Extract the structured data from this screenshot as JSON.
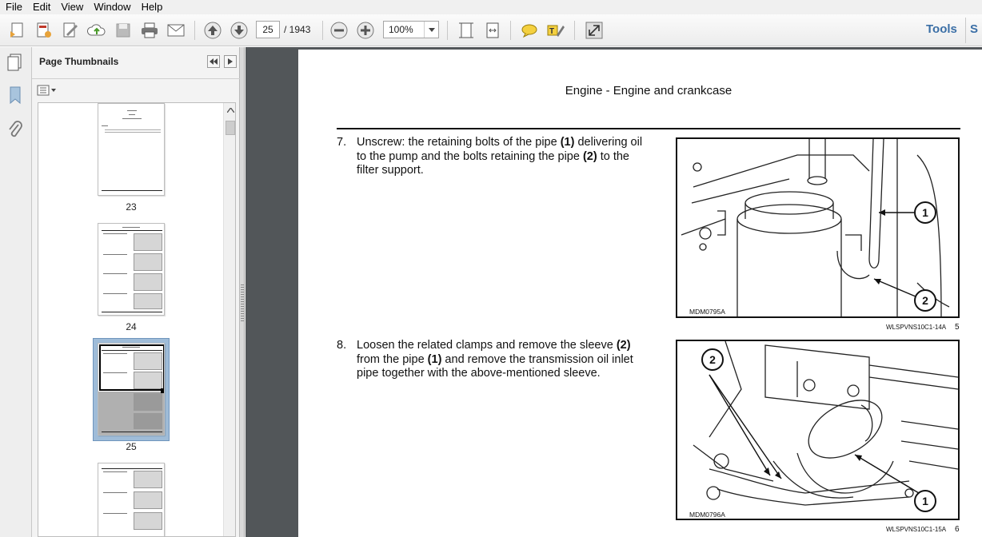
{
  "menu": [
    "File",
    "Edit",
    "View",
    "Window",
    "Help"
  ],
  "toolbar": {
    "icons": [
      "create-icon",
      "edit-pdf-icon",
      "sign-icon",
      "cloud-upload-icon",
      "save-icon",
      "print-icon",
      "email-icon",
      "previous-page-icon",
      "next-page-icon",
      "zoom-out-icon",
      "zoom-in-icon",
      "fit-page-icon",
      "fit-width-icon",
      "comment-icon",
      "highlight-icon",
      "fullscreen-icon"
    ],
    "current_page": "25",
    "page_total": "/ 1943",
    "zoom": "100%",
    "tools_label": "Tools",
    "next_panel_label": "S"
  },
  "thumbnails": {
    "title": "Page Thumbnails",
    "pages": [
      {
        "number": "23",
        "selected": false
      },
      {
        "number": "24",
        "selected": false
      },
      {
        "number": "25",
        "selected": true
      },
      {
        "number": "",
        "selected": false
      }
    ]
  },
  "document": {
    "header": "Engine - Engine and crankcase",
    "steps": [
      {
        "number": "7.",
        "parts": [
          {
            "t": "Unscrew: the retaining bolts of the pipe ",
            "b": false
          },
          {
            "t": "(1)",
            "b": true
          },
          {
            "t": " delivering oil to the pump and the bolts retaining the pipe ",
            "b": false
          },
          {
            "t": "(2)",
            "b": true
          },
          {
            "t": " to the filter support.",
            "b": false
          }
        ],
        "figure_code": "MDM0795A",
        "figure_ref": "WLSPVNS10C1-14A",
        "figure_num": "5",
        "callouts": [
          "1",
          "2"
        ]
      },
      {
        "number": "8.",
        "parts": [
          {
            "t": "Loosen the related clamps and remove the sleeve ",
            "b": false
          },
          {
            "t": "(2)",
            "b": true
          },
          {
            "t": " from the pipe ",
            "b": false
          },
          {
            "t": "(1)",
            "b": true
          },
          {
            "t": " and remove the transmission oil inlet pipe together with the above-mentioned sleeve.",
            "b": false
          }
        ],
        "figure_code": "MDM0796A",
        "figure_ref": "WLSPVNS10C1-15A",
        "figure_num": "6",
        "callouts": [
          "2",
          "1"
        ]
      }
    ]
  }
}
